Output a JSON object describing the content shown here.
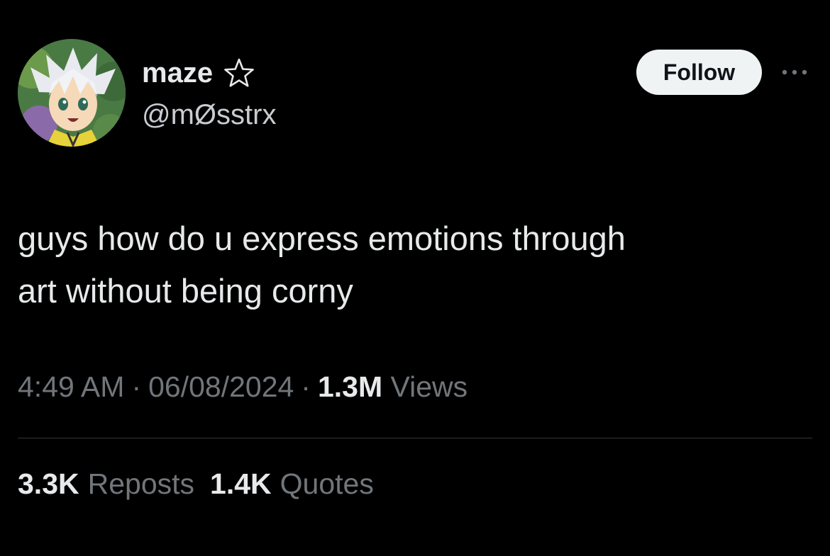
{
  "user": {
    "display_name": "maze",
    "handle": "@mØsstrx",
    "badge_icon": "star-outline-icon",
    "avatar_icon": "anime-avatar"
  },
  "actions": {
    "follow_label": "Follow",
    "more_icon": "more-horizontal-icon"
  },
  "tweet": {
    "text_lines": [
      "guys how do u express emotions through",
      "art without being corny"
    ]
  },
  "meta": {
    "time": "4:49 AM",
    "date": "06/08/2024",
    "views_count": "1.3M",
    "views_label": "Views",
    "separator": "·"
  },
  "stats": {
    "reposts_count": "3.3K",
    "reposts_label": "Reposts",
    "quotes_count": "1.4K",
    "quotes_label": "Quotes"
  },
  "colors": {
    "background": "#000000",
    "primary_text": "#e7e9ea",
    "secondary_text": "#71767b",
    "divider": "#2f3336",
    "follow_bg": "#eff3f4"
  }
}
